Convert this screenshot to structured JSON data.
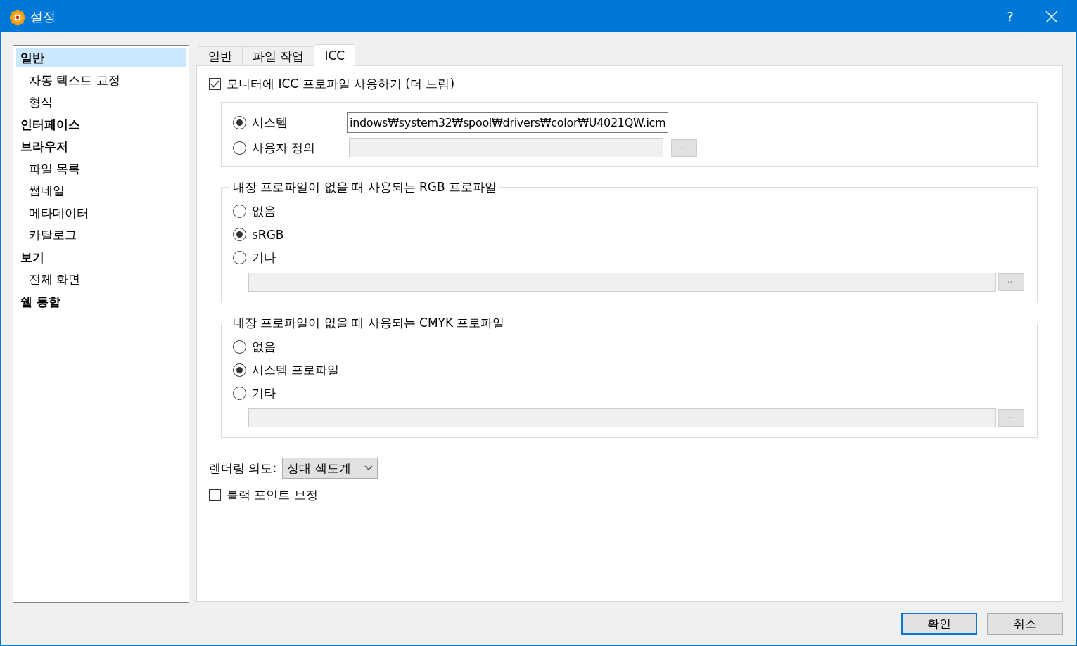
{
  "window": {
    "title": "설정",
    "help": "?"
  },
  "sidebar": {
    "items": [
      {
        "label": "일반",
        "selected": true,
        "children": [
          {
            "label": "자동 텍스트 교정",
            "selected": false
          },
          {
            "label": "형식",
            "selected": false
          }
        ]
      },
      {
        "label": "인터페이스",
        "selected": false
      },
      {
        "label": "브라우저",
        "selected": false,
        "children": [
          {
            "label": "파일 목록",
            "selected": false
          },
          {
            "label": "썸네일",
            "selected": false
          },
          {
            "label": "메타데이터",
            "selected": false
          },
          {
            "label": "카탈로그",
            "selected": false
          }
        ]
      },
      {
        "label": "보기",
        "selected": false,
        "children": [
          {
            "label": "전체 화면",
            "selected": false
          }
        ]
      },
      {
        "label": "쉘 통합",
        "selected": false
      }
    ]
  },
  "tabs": [
    {
      "label": "일반",
      "selected": false
    },
    {
      "label": "파일 작업",
      "selected": false
    },
    {
      "label": "ICC",
      "selected": true
    }
  ],
  "monitor": {
    "label": "모니터에 ICC 프로파일 사용하기 (더 느림)",
    "checked": true,
    "options": [
      {
        "label": "시스템",
        "selected": true,
        "field": {
          "value": "indows₩system32₩spool₩drivers₩color₩U4021QW.icm",
          "disabled": false
        }
      },
      {
        "label": "사용자 정의",
        "selected": false,
        "field": {
          "disabled": true
        },
        "browse": "···"
      }
    ]
  },
  "groups": [
    {
      "title": "내장 프로파일이 없을 때 사용되는 RGB 프로파일",
      "options": [
        {
          "label": "없음",
          "selected": false
        },
        {
          "label": "sRGB",
          "selected": true
        },
        {
          "label": "기타",
          "selected": false
        }
      ],
      "field": {
        "disabled": true
      },
      "browse": "···"
    },
    {
      "title": "내장 프로파일이 없을 때 사용되는 CMYK 프로파일",
      "options": [
        {
          "label": "없음",
          "selected": false
        },
        {
          "label": "시스템 프로파일",
          "selected": true
        },
        {
          "label": "기타",
          "selected": false
        }
      ],
      "field": {
        "disabled": true
      },
      "browse": "···"
    }
  ],
  "rendering_intent": {
    "label": "렌더링 의도:",
    "value": "상대 색도계"
  },
  "black_point": {
    "label": "블랙 포인트 보정",
    "checked": false
  },
  "buttons": [
    {
      "label": "확인",
      "default": true
    },
    {
      "label": "취소",
      "default": false
    }
  ]
}
